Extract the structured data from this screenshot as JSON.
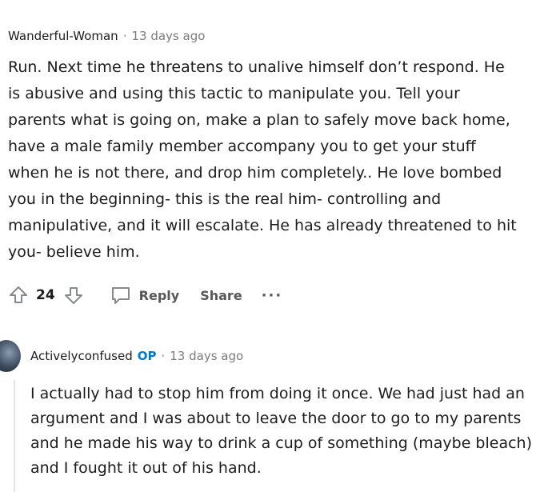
{
  "comment1": {
    "author": "Wanderful-Woman",
    "separator": "·",
    "time": "13 days ago",
    "body": "Run. Next time he threatens to unalive himself don’t respond. He is abusive and using this tactic to manipulate you. Tell your parents what is going on, make a plan to safely move back home, have a male family member accompany you to get your stuff when he is not there, and drop him completely.. He love bombed you in the beginning- this is the real him- controlling and manipulative, and it will escalate. He has already threatened to hit you- believe him.",
    "vote_count": "24",
    "reply_label": "Reply",
    "share_label": "Share",
    "more_label": "···"
  },
  "comment2": {
    "author": "Activelyconfused",
    "op_badge": "OP",
    "separator": "·",
    "time": "13 days ago",
    "body": "I actually had to stop him from doing it once. We had just had an argument and I was about to leave the door to go to my parents and he made his way to drink a cup of something (maybe bleach) and I fought it out of his hand."
  }
}
